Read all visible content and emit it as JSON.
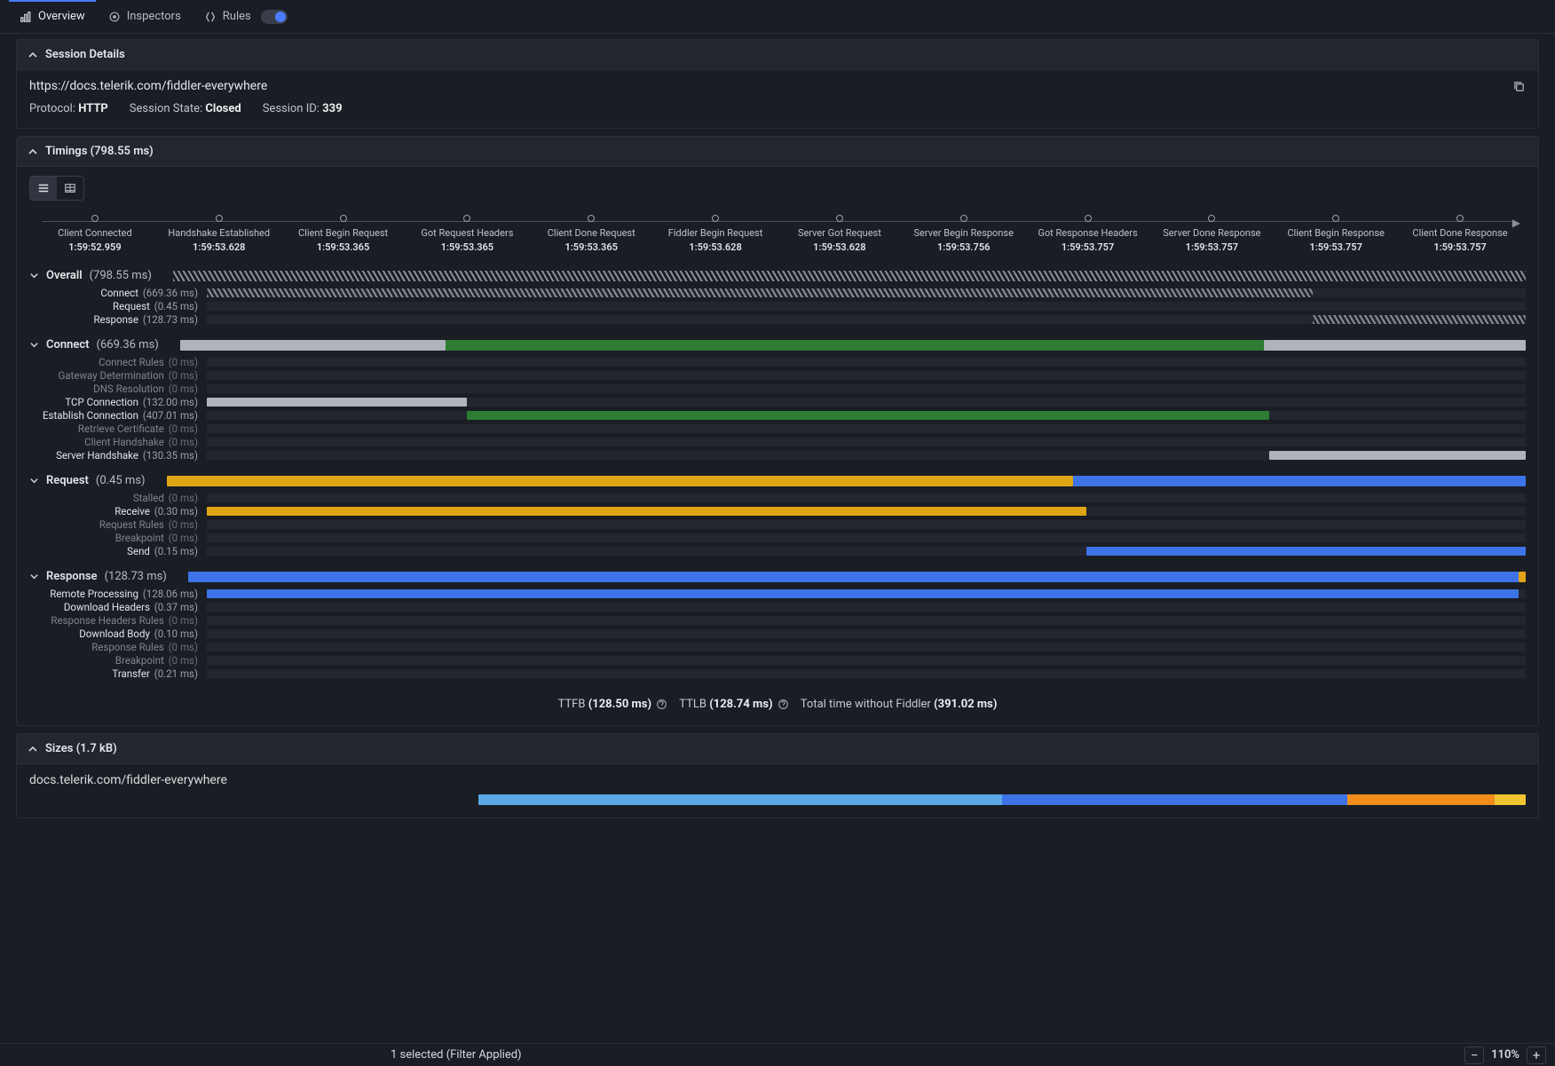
{
  "tabs": {
    "overview": "Overview",
    "inspectors": "Inspectors",
    "rules": "Rules"
  },
  "session": {
    "header": "Session Details",
    "url": "https://docs.telerik.com/fiddler-everywhere",
    "protocol_label": "Protocol:",
    "protocol_value": "HTTP",
    "state_label": "Session State:",
    "state_value": "Closed",
    "id_label": "Session ID:",
    "id_value": "339"
  },
  "timings": {
    "header": "Timings (798.55 ms)",
    "milestones": [
      {
        "label": "Client Connected",
        "time": "1:59:52.959"
      },
      {
        "label": "Handshake Established",
        "time": "1:59:53.628"
      },
      {
        "label": "Client Begin Request",
        "time": "1:59:53.365"
      },
      {
        "label": "Got Request Headers",
        "time": "1:59:53.365"
      },
      {
        "label": "Client Done Request",
        "time": "1:59:53.365"
      },
      {
        "label": "Fiddler Begin Request",
        "time": "1:59:53.628"
      },
      {
        "label": "Server Got Request",
        "time": "1:59:53.628"
      },
      {
        "label": "Server Begin Response",
        "time": "1:59:53.756"
      },
      {
        "label": "Got Response Headers",
        "time": "1:59:53.757"
      },
      {
        "label": "Server Done Response",
        "time": "1:59:53.757"
      },
      {
        "label": "Client Begin Response",
        "time": "1:59:53.757"
      },
      {
        "label": "Client Done Response",
        "time": "1:59:53.757"
      }
    ],
    "overall": {
      "title": "Overall",
      "dur": "(798.55 ms)",
      "rows": [
        {
          "name": "Connect",
          "dur": "(669.36 ms)",
          "dim": false
        },
        {
          "name": "Request",
          "dur": "(0.45 ms)",
          "dim": false
        },
        {
          "name": "Response",
          "dur": "(128.73 ms)",
          "dim": false
        }
      ]
    },
    "connect": {
      "title": "Connect",
      "dur": "(669.36 ms)",
      "rows": [
        {
          "name": "Connect Rules",
          "dur": "(0 ms)",
          "dim": true
        },
        {
          "name": "Gateway Determination",
          "dur": "(0 ms)",
          "dim": true
        },
        {
          "name": "DNS Resolution",
          "dur": "(0 ms)",
          "dim": true
        },
        {
          "name": "TCP Connection",
          "dur": "(132.00 ms)",
          "dim": false
        },
        {
          "name": "Establish Connection",
          "dur": "(407.01 ms)",
          "dim": false
        },
        {
          "name": "Retrieve Certificate",
          "dur": "(0 ms)",
          "dim": true
        },
        {
          "name": "Client Handshake",
          "dur": "(0 ms)",
          "dim": true
        },
        {
          "name": "Server Handshake",
          "dur": "(130.35 ms)",
          "dim": false
        }
      ]
    },
    "request": {
      "title": "Request",
      "dur": "(0.45 ms)",
      "rows": [
        {
          "name": "Stalled",
          "dur": "(0 ms)",
          "dim": true
        },
        {
          "name": "Receive",
          "dur": "(0.30 ms)",
          "dim": false
        },
        {
          "name": "Request Rules",
          "dur": "(0 ms)",
          "dim": true
        },
        {
          "name": "Breakpoint",
          "dur": "(0 ms)",
          "dim": true
        },
        {
          "name": "Send",
          "dur": "(0.15 ms)",
          "dim": false
        }
      ]
    },
    "response": {
      "title": "Response",
      "dur": "(128.73 ms)",
      "rows": [
        {
          "name": "Remote Processing",
          "dur": "(128.06 ms)",
          "dim": false
        },
        {
          "name": "Download Headers",
          "dur": "(0.37 ms)",
          "dim": false
        },
        {
          "name": "Response Headers Rules",
          "dur": "(0 ms)",
          "dim": true
        },
        {
          "name": "Download Body",
          "dur": "(0.10 ms)",
          "dim": false
        },
        {
          "name": "Response Rules",
          "dur": "(0 ms)",
          "dim": true
        },
        {
          "name": "Breakpoint",
          "dur": "(0 ms)",
          "dim": true
        },
        {
          "name": "Transfer",
          "dur": "(0.21 ms)",
          "dim": false
        }
      ]
    },
    "summary": {
      "ttfb_label": "TTFB",
      "ttfb_value": "(128.50 ms)",
      "ttlb_label": "TTLB",
      "ttlb_value": "(128.74 ms)",
      "total_label": "Total time without Fiddler",
      "total_value": "(391.02 ms)"
    }
  },
  "sizes": {
    "header": "Sizes (1.7 kB)",
    "url": "docs.telerik.com/fiddler-everywhere"
  },
  "statusbar": {
    "center": "1 selected (Filter Applied)",
    "zoom": "110%"
  },
  "colors": {
    "gray": "#aeb3bc",
    "green": "#2e7d32",
    "orange": "#e0a516",
    "blue": "#3d73e6",
    "lblue": "#5aa9e6",
    "deepor": "#f28c1a",
    "yellow": "#f0c531"
  },
  "chart_data": {
    "type": "bar",
    "title": "Session timings waterfall",
    "unit": "ms",
    "total": 798.55,
    "overall_head": {
      "start": 0.0,
      "end": 798.55,
      "style": "hatch"
    },
    "overall": [
      {
        "name": "Connect",
        "start": 0.0,
        "end": 669.36,
        "style": "hatch"
      },
      {
        "name": "Request",
        "start": 669.36,
        "end": 669.81,
        "tick": true
      },
      {
        "name": "Response",
        "start": 669.81,
        "end": 798.55,
        "style": "hatch"
      }
    ],
    "connect_head": [
      {
        "start": 0.0,
        "end": 132.0,
        "color": "gray"
      },
      {
        "start": 132.0,
        "end": 539.01,
        "color": "green"
      },
      {
        "start": 539.01,
        "end": 669.36,
        "color": "gray"
      }
    ],
    "connect": [
      {
        "name": "Connect Rules",
        "start": 0,
        "end": 0
      },
      {
        "name": "Gateway Determination",
        "start": 0,
        "end": 0
      },
      {
        "name": "DNS Resolution",
        "start": 0,
        "end": 0
      },
      {
        "name": "TCP Connection",
        "start": 0.0,
        "end": 132.0,
        "color": "gray"
      },
      {
        "name": "Establish Connection",
        "start": 132.0,
        "end": 539.01,
        "color": "green"
      },
      {
        "name": "Retrieve Certificate",
        "start": 0,
        "end": 0
      },
      {
        "name": "Client Handshake",
        "start": 0,
        "end": 0
      },
      {
        "name": "Server Handshake",
        "start": 539.01,
        "end": 669.36,
        "color": "gray"
      }
    ],
    "request_head": [
      {
        "start": 0.0,
        "end": 0.3,
        "color": "orange",
        "of": 0.45
      },
      {
        "start": 0.3,
        "end": 0.45,
        "color": "blue",
        "of": 0.45
      }
    ],
    "request": [
      {
        "name": "Stalled",
        "start": 0,
        "end": 0,
        "of": 0.45
      },
      {
        "name": "Receive",
        "start": 0.0,
        "end": 0.3,
        "of": 0.45,
        "color": "orange"
      },
      {
        "name": "Request Rules",
        "start": 0,
        "end": 0,
        "of": 0.45
      },
      {
        "name": "Breakpoint",
        "start": 0,
        "end": 0,
        "of": 0.45
      },
      {
        "name": "Send",
        "start": 0.3,
        "end": 0.45,
        "of": 0.45,
        "color": "blue"
      }
    ],
    "response_head": [
      {
        "start": 0.0,
        "end": 128.06,
        "color": "blue",
        "of": 128.73
      },
      {
        "start": 128.06,
        "end": 128.73,
        "color": "orange",
        "of": 128.73
      }
    ],
    "response": [
      {
        "name": "Remote Processing",
        "start": 0.0,
        "end": 128.06,
        "of": 128.73,
        "color": "blue"
      },
      {
        "name": "Download Headers",
        "start": 128.06,
        "end": 128.43,
        "of": 128.73,
        "tick": true,
        "tickcolor": "blue"
      },
      {
        "name": "Response Headers Rules",
        "start": 0,
        "end": 0,
        "of": 128.73
      },
      {
        "name": "Download Body",
        "start": 128.43,
        "end": 128.53,
        "of": 128.73,
        "tick": true,
        "tickcolor": "blue"
      },
      {
        "name": "Response Rules",
        "start": 0,
        "end": 0,
        "of": 128.73
      },
      {
        "name": "Breakpoint",
        "start": 0,
        "end": 0,
        "of": 128.73
      },
      {
        "name": "Transfer",
        "start": 128.52,
        "end": 128.73,
        "of": 128.73,
        "tick": true,
        "tickcolor": "orange"
      }
    ],
    "sizes_bar": [
      {
        "pct": 50,
        "color": "lblue"
      },
      {
        "pct": 33,
        "color": "blue"
      },
      {
        "pct": 14,
        "color": "deepor"
      },
      {
        "pct": 3,
        "color": "yellow"
      }
    ]
  }
}
